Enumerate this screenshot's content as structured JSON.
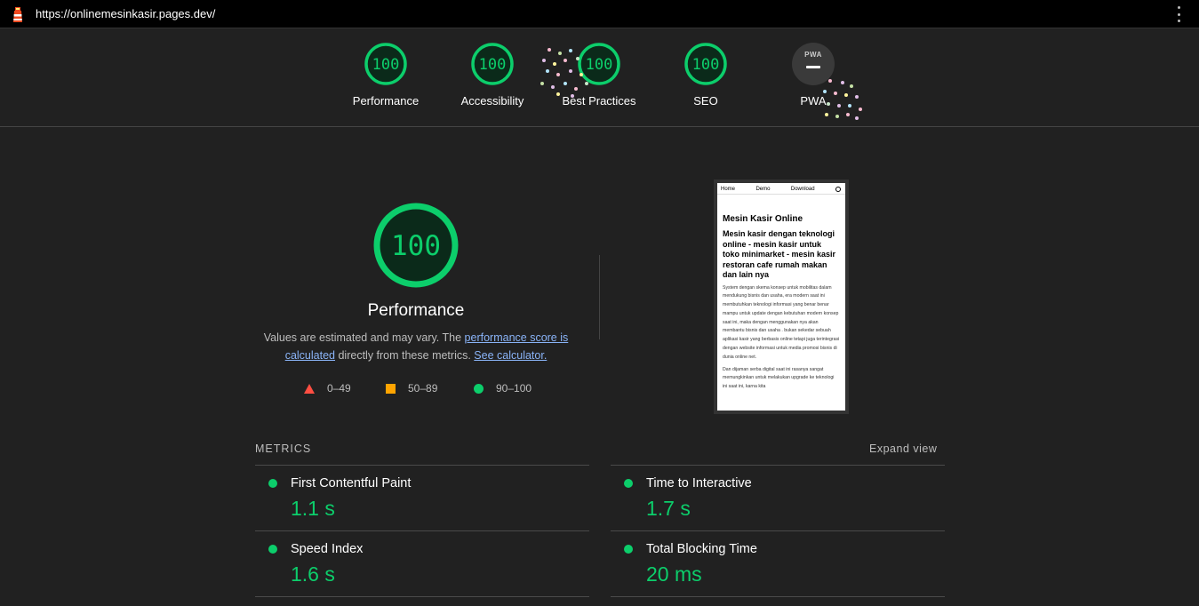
{
  "topbar": {
    "url": "https://onlinemesinkasir.pages.dev/"
  },
  "colors": {
    "pass": "#0cce6b",
    "average": "#ffa400",
    "fail": "#ff4e42",
    "background": "#212121"
  },
  "categories": [
    {
      "label": "Performance",
      "score": 100
    },
    {
      "label": "Accessibility",
      "score": 100
    },
    {
      "label": "Best Practices",
      "score": 100
    },
    {
      "label": "SEO",
      "score": 100
    },
    {
      "label": "PWA",
      "badge": "PWA"
    }
  ],
  "performance": {
    "score": 100,
    "title": "Performance",
    "desc_prefix": "Values are estimated and may vary. The ",
    "desc_link1": "performance score is calculated",
    "desc_middle": " directly from these metrics. ",
    "desc_link2": "See calculator."
  },
  "legend": [
    {
      "range": "0–49",
      "icon": "triangle-icon"
    },
    {
      "range": "50–89",
      "icon": "square-icon"
    },
    {
      "range": "90–100",
      "icon": "circle-icon"
    }
  ],
  "screenshot": {
    "nav": [
      "Home",
      "Demo",
      "Download"
    ],
    "title": "Mesin Kasir Online",
    "subtitle": "Mesin kasir dengan teknologi online - mesin kasir untuk toko minimarket - mesin kasir restoran cafe rumah makan dan lain nya",
    "para1": "System dengan skema konsep untuk mobilitas dalam mendukung bisnis dan usaha, era modern saat ini membutuhkan teknologi informasi yang benar benar mampu untuk update dengan kebutuhan modern konsep saat ini, maka dengan menggunakan nya akan membantu bisnis dan usaha . bukan sekedar sebuah aplikasi kasir yang berbasis online tetapi juga terintegrasi dengan website informasi untuk media promosi bisnis di dunia online net.",
    "para2": "Dan dijaman serba digital saat ini rasanya sangat memungkinkan untuk melakukan upgrade ke teknologi ini saat ini, karna kita"
  },
  "metrics": {
    "heading": "METRICS",
    "expand_label": "Expand view",
    "left": [
      {
        "name": "First Contentful Paint",
        "value": "1.1 s"
      },
      {
        "name": "Speed Index",
        "value": "1.6 s"
      }
    ],
    "right": [
      {
        "name": "Time to Interactive",
        "value": "1.7 s"
      },
      {
        "name": "Total Blocking Time",
        "value": "20 ms"
      }
    ]
  }
}
